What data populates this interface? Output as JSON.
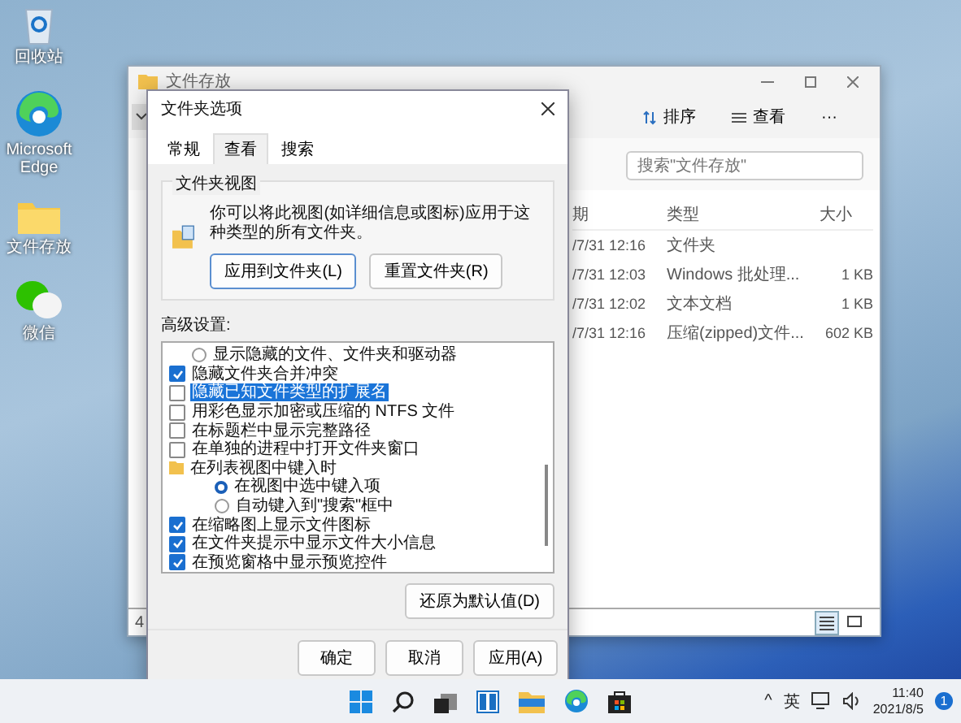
{
  "desktop_icons": [
    {
      "kind": "recycle",
      "label": "回收站"
    },
    {
      "kind": "edge",
      "label": "Microsoft Edge"
    },
    {
      "kind": "folder",
      "label": "文件存放"
    },
    {
      "kind": "wechat",
      "label": "微信"
    }
  ],
  "explorer": {
    "title": "文件存放",
    "toolbar": [
      {
        "kind": "sort",
        "label": "排序"
      },
      {
        "kind": "view",
        "label": "查看"
      },
      {
        "kind": "more",
        "label": "···"
      }
    ],
    "search": {
      "placeholder": "搜索\"文件存放\""
    },
    "columns": [
      "期",
      "类型",
      "大小"
    ],
    "rows": [
      {
        "date": "/7/31 12:16",
        "type": "文件夹",
        "size": ""
      },
      {
        "date": "/7/31 12:03",
        "type": "Windows 批处理...",
        "size": "1 KB"
      },
      {
        "date": "/7/31 12:02",
        "type": "文本文档",
        "size": "1 KB"
      },
      {
        "date": "/7/31 12:16",
        "type": "压缩(zipped)文件...",
        "size": "602 KB"
      }
    ],
    "status": "4",
    "view_modes": [
      {
        "kind": "details",
        "selected": true
      },
      {
        "kind": "tiles",
        "selected": false
      }
    ]
  },
  "dialog": {
    "title": "文件夹选项",
    "tabs": [
      {
        "label": "常规",
        "selected": false
      },
      {
        "label": "查看",
        "selected": true
      },
      {
        "label": "搜索",
        "selected": false
      }
    ],
    "group_title": "文件夹视图",
    "group_text": "你可以将此视图(如详细信息或图标)应用于这种类型的所有文件夹。",
    "group_buttons": [
      "应用到文件夹(L)",
      "重置文件夹(R)"
    ],
    "advanced_label": "高级设置:",
    "settings": [
      {
        "kind": "radio",
        "label": "显示隐藏的文件、文件夹和驱动器",
        "checked": false,
        "selected": false
      },
      {
        "kind": "checkbox",
        "label": "隐藏文件夹合并冲突",
        "checked": true,
        "selected": false
      },
      {
        "kind": "checkbox",
        "label": "隐藏已知文件类型的扩展名",
        "checked": false,
        "selected": true
      },
      {
        "kind": "checkbox",
        "label": "用彩色显示加密或压缩的 NTFS 文件",
        "checked": false,
        "selected": false
      },
      {
        "kind": "checkbox",
        "label": "在标题栏中显示完整路径",
        "checked": false,
        "selected": false
      },
      {
        "kind": "checkbox",
        "label": "在单独的进程中打开文件夹窗口",
        "checked": false,
        "selected": false
      },
      {
        "kind": "folder",
        "label": "在列表视图中键入时",
        "selected": false,
        "children": [
          {
            "kind": "radio",
            "label": "在视图中选中键入项",
            "checked": true,
            "selected": false
          },
          {
            "kind": "radio",
            "label": "自动键入到\"搜索\"框中",
            "checked": false,
            "selected": false
          }
        ]
      },
      {
        "kind": "checkbox",
        "label": "在缩略图上显示文件图标",
        "checked": true,
        "selected": false
      },
      {
        "kind": "checkbox",
        "label": "在文件夹提示中显示文件大小信息",
        "checked": true,
        "selected": false
      },
      {
        "kind": "checkbox",
        "label": "在预览窗格中显示预览控件",
        "checked": true,
        "selected": false
      }
    ],
    "restore_button": "还原为默认值(D)",
    "buttons": [
      "确定",
      "取消",
      "应用(A)"
    ]
  },
  "taskbar": {
    "apps": [
      {
        "kind": "start"
      },
      {
        "kind": "search"
      },
      {
        "kind": "taskview"
      },
      {
        "kind": "widgets"
      },
      {
        "kind": "explorer"
      },
      {
        "kind": "edge"
      },
      {
        "kind": "store"
      }
    ],
    "tray": {
      "chevron": "^",
      "ime": "英",
      "time": "11:40",
      "date": "2021/8/5",
      "badge": "1"
    }
  }
}
